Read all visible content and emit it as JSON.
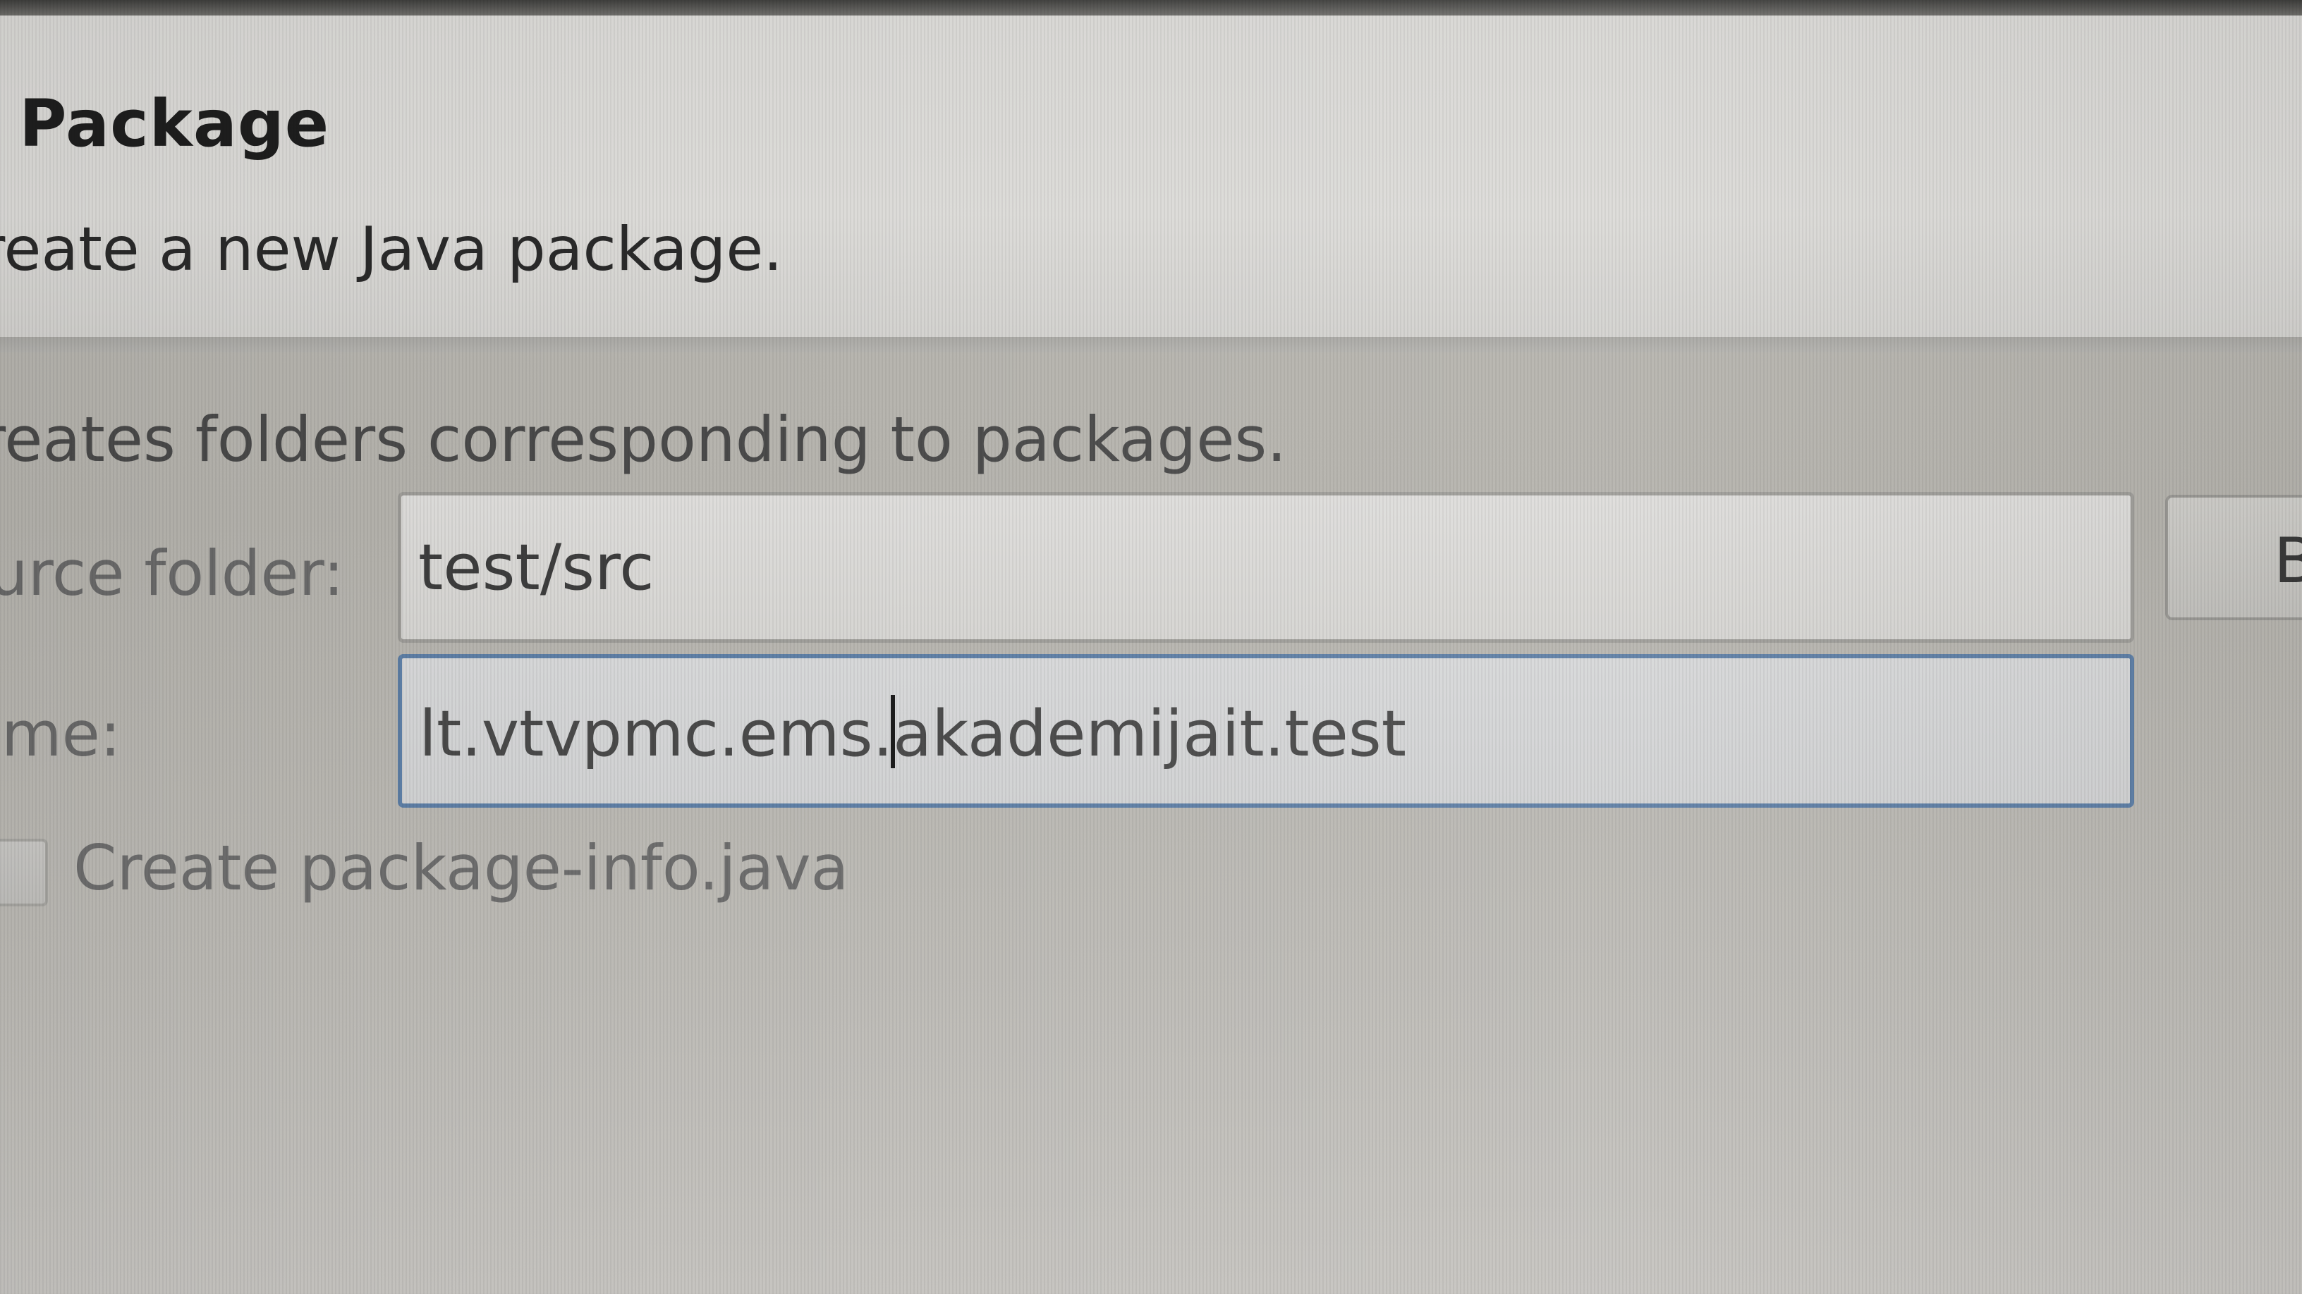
{
  "wizard": {
    "title": "va Package",
    "description": "reate a new Java package."
  },
  "form": {
    "hint": "reates folders corresponding to packages.",
    "source_folder": {
      "label": "ource folder:",
      "value": "test/src",
      "browse_label": "B"
    },
    "name": {
      "label": "ame:",
      "value_before_caret": "lt.vtvpmc.ems.",
      "value_after_caret": "akademijait.test"
    },
    "create_package_info": {
      "label": "Create package-info.java",
      "checked": false
    }
  },
  "colors": {
    "focus_border": "#5e7fa6",
    "banner_background": "#dcdbd8",
    "body_background": "#b7b5af"
  }
}
